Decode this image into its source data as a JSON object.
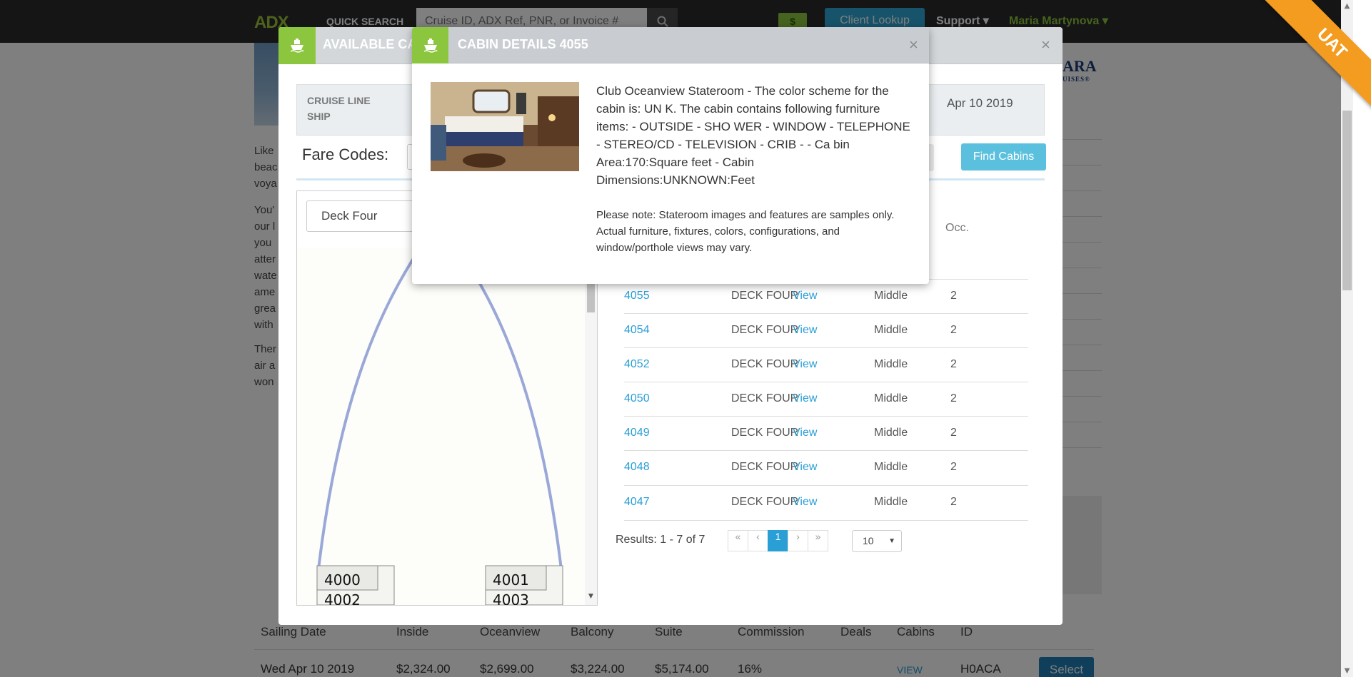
{
  "topbar": {
    "logo_main": "ADX",
    "logo_accent": "",
    "quick_search_label": "QUICK SEARCH",
    "search_placeholder": "Cruise ID, ADX Ref, PNR, or Invoice #",
    "dollar_label": "$",
    "client_lookup_label": "Client Lookup",
    "support_label": "Support ▾",
    "user_label": "Maria Martynova ▾"
  },
  "background": {
    "brand_logo": "ARA",
    "brand_logo_sub": "UISES®",
    "paragraphs": [
      [
        "Like",
        "beac",
        "voya"
      ],
      [
        "You'",
        "our l",
        "you",
        "atter",
        "wate",
        "ame",
        "grea",
        "with"
      ],
      [
        "Ther",
        "air a",
        "won"
      ]
    ],
    "sailing_headers": [
      "Sailing Date",
      "Inside",
      "Oceanview",
      "Balcony",
      "Suite",
      "Commission",
      "Deals",
      "Cabins",
      "ID"
    ],
    "sailing_row": [
      "Wed Apr 10 2019",
      "$2,324.00",
      "$2,699.00",
      "$3,224.00",
      "$5,174.00",
      "16%",
      "",
      "VIEW",
      "H0ACA"
    ],
    "select_label": "Select"
  },
  "available_modal": {
    "title": "AVAILABLE CABINS",
    "close": "×",
    "cruise_line_label": "CRUISE LINE",
    "ship_label": "SHIP",
    "date_text": "Apr 10 2019",
    "fare_codes_label": "Fare Codes:",
    "find_cabins_label": "Find Cabins",
    "deck_selected": "Deck Four",
    "deck_cabin_labels": [
      "4000",
      "4002",
      "4001",
      "4003"
    ],
    "occ_header": "Occ.",
    "view_label": "View",
    "rows": [
      {
        "cabin": "4055",
        "deck": "DECK FOUR",
        "location": "Middle",
        "occ": "2"
      },
      {
        "cabin": "4054",
        "deck": "DECK FOUR",
        "location": "Middle",
        "occ": "2"
      },
      {
        "cabin": "4052",
        "deck": "DECK FOUR",
        "location": "Middle",
        "occ": "2"
      },
      {
        "cabin": "4050",
        "deck": "DECK FOUR",
        "location": "Middle",
        "occ": "2"
      },
      {
        "cabin": "4049",
        "deck": "DECK FOUR",
        "location": "Middle",
        "occ": "2"
      },
      {
        "cabin": "4048",
        "deck": "DECK FOUR",
        "location": "Middle",
        "occ": "2"
      },
      {
        "cabin": "4047",
        "deck": "DECK FOUR",
        "location": "Middle",
        "occ": "2"
      }
    ],
    "results_text": "Results: 1 - 7 of 7",
    "pager": [
      "«",
      "‹",
      "1",
      "›",
      "»"
    ],
    "per_page": "10"
  },
  "details_modal": {
    "title": "CABIN DETAILS 4055",
    "close": "×",
    "description": "Club Oceanview Stateroom - The color scheme for the cabin is: UN K. The cabin contains following furniture items: - OUTSIDE - SHO WER - WINDOW - TELEPHONE - STEREO/CD - TELEVISION - CRIB - - Ca bin Area:170:Square feet - Cabin Dimensions:UNKNOWN:Feet",
    "note": "Please note: Stateroom images and features are samples only. Actual furniture, fixtures, colors, configurations, and window/porthole views may vary."
  },
  "env_badge": "UAT",
  "colors": {
    "brand_green": "#8cc63f",
    "link_blue": "#2a9fd6",
    "ribbon_orange": "#f39c1f"
  }
}
